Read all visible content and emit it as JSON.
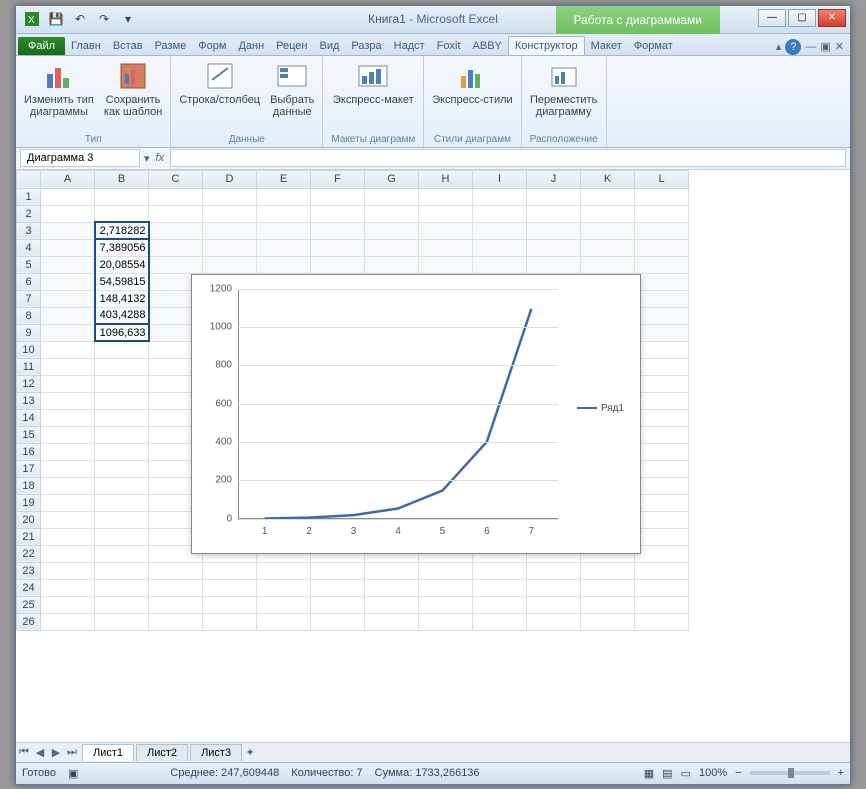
{
  "title": {
    "doc": "Книга1",
    "app": "Microsoft Excel",
    "chart_tools": "Работа с диаграммами"
  },
  "tabs": {
    "file": "Файл",
    "items": [
      "Главн",
      "Встав",
      "Разме",
      "Форм",
      "Данн",
      "Рецен",
      "Вид",
      "Разра",
      "Надст",
      "Foxit",
      "ABBY"
    ],
    "ctx": [
      "Конструктор",
      "Макет",
      "Формат"
    ]
  },
  "ribbon": {
    "g1": {
      "label": "Тип",
      "a": "Изменить тип\nдиаграммы",
      "b": "Сохранить\nкак шаблон"
    },
    "g2": {
      "label": "Данные",
      "a": "Строка/столбец",
      "b": "Выбрать\nданные"
    },
    "g3": {
      "label": "Макеты диаграмм",
      "a": "Экспресс-макет"
    },
    "g4": {
      "label": "Стили диаграмм",
      "a": "Экспресс-стили"
    },
    "g5": {
      "label": "Расположение",
      "a": "Переместить\nдиаграмму"
    }
  },
  "namebox": "Диаграмма 3",
  "columns": [
    "A",
    "B",
    "C",
    "D",
    "E",
    "F",
    "G",
    "H",
    "I",
    "J",
    "K",
    "L"
  ],
  "rows": 26,
  "cells": {
    "B3": "2,718282",
    "B4": "7,389056",
    "B5": "20,08554",
    "B6": "54,59815",
    "B7": "148,4132",
    "B8": "403,4288",
    "B9": "1096,633"
  },
  "chart_data": {
    "type": "line",
    "categories": [
      1,
      2,
      3,
      4,
      5,
      6,
      7
    ],
    "series": [
      {
        "name": "Ряд1",
        "values": [
          2.718282,
          7.389056,
          20.08554,
          54.59815,
          148.4132,
          403.4288,
          1096.633
        ]
      }
    ],
    "ylim": [
      0,
      1200
    ],
    "yticks": [
      0,
      200,
      400,
      600,
      800,
      1000,
      1200
    ]
  },
  "sheets": [
    "Лист1",
    "Лист2",
    "Лист3"
  ],
  "status": {
    "ready": "Готово",
    "avg_label": "Среднее:",
    "avg": "247,609448",
    "cnt_label": "Количество:",
    "cnt": "7",
    "sum_label": "Сумма:",
    "sum": "1733,266136",
    "zoom": "100%"
  }
}
